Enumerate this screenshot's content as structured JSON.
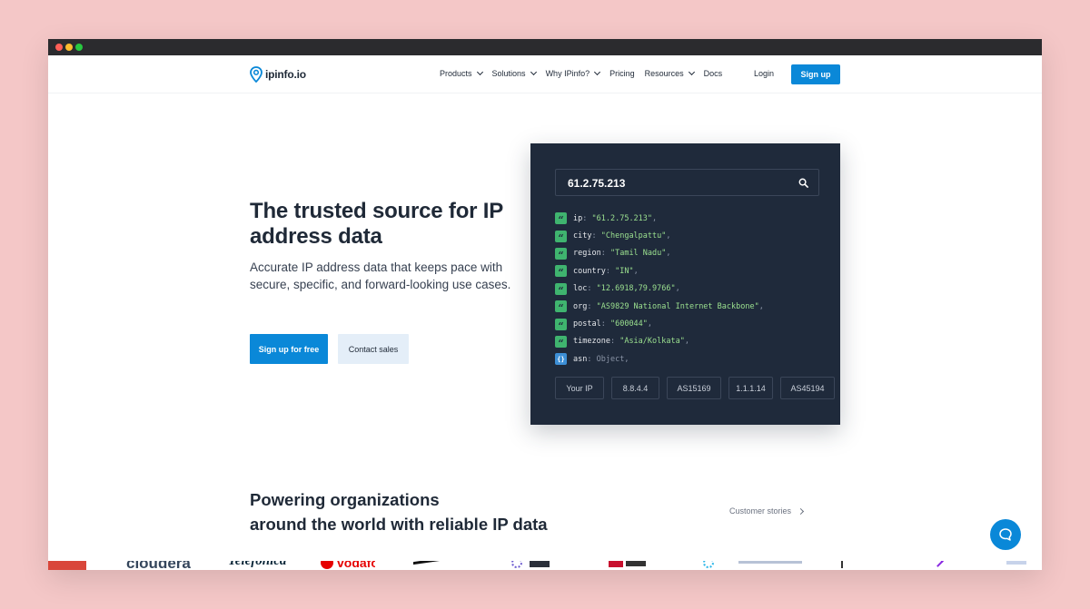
{
  "brand": {
    "name": "ipinfo.io",
    "accent": "#0a88d8",
    "panel_bg": "#1f2a3b"
  },
  "nav": {
    "items": [
      {
        "label": "Products",
        "dropdown": true
      },
      {
        "label": "Solutions",
        "dropdown": true
      },
      {
        "label": "Why IPinfo?",
        "dropdown": true
      },
      {
        "label": "Pricing",
        "dropdown": false
      },
      {
        "label": "Resources",
        "dropdown": true
      },
      {
        "label": "Docs",
        "dropdown": false
      }
    ],
    "login": "Login",
    "signup": "Sign up"
  },
  "hero": {
    "title": "The trusted source for IP address data",
    "subtitle": "Accurate IP address data that keeps pace with secure, specific, and forward-looking use cases.",
    "primary_cta": "Sign up for free",
    "secondary_cta": "Contact sales"
  },
  "lookup": {
    "query": "61.2.75.213",
    "fields": [
      {
        "key": "ip",
        "value": "\"61.2.75.213\"",
        "type": "string"
      },
      {
        "key": "city",
        "value": "\"Chengalpattu\"",
        "type": "string"
      },
      {
        "key": "region",
        "value": "\"Tamil Nadu\"",
        "type": "string"
      },
      {
        "key": "country",
        "value": "\"IN\"",
        "type": "string"
      },
      {
        "key": "loc",
        "value": "\"12.6918,79.9766\"",
        "type": "string"
      },
      {
        "key": "org",
        "value": "\"AS9829 National Internet Backbone\"",
        "type": "string"
      },
      {
        "key": "postal",
        "value": "\"600044\"",
        "type": "string"
      },
      {
        "key": "timezone",
        "value": "\"Asia/Kolkata\"",
        "type": "string"
      },
      {
        "key": "asn",
        "value": "Object",
        "type": "object"
      }
    ],
    "quick_lookups": [
      "Your IP",
      "8.8.4.4",
      "AS15169",
      "1.1.1.14",
      "AS45194"
    ]
  },
  "orgs": {
    "title_line1": "Powering organizations",
    "title_line2": "around the world with reliable IP data",
    "stories_link": "Customer stories",
    "logos": [
      "cloudera",
      "Telefónica",
      "vodafone"
    ]
  }
}
